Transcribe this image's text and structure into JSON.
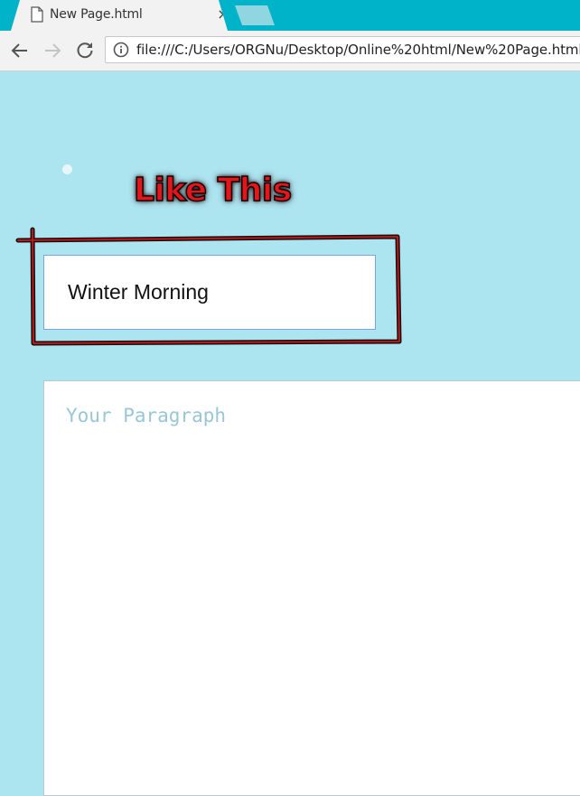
{
  "browser": {
    "tab_title": "New Page.html",
    "tab_close_glyph": "×",
    "address": "file:///C:/Users/ORGNu/Desktop/Online%20html/New%20Page.html"
  },
  "annotation": {
    "label": "Like This",
    "color": "#e2161b"
  },
  "form": {
    "title_value": "Winter Morning",
    "paragraph_placeholder": "Your Paragraph"
  },
  "colors": {
    "tabstrip": "#00b3c8",
    "page_background": "#ace4f0"
  }
}
